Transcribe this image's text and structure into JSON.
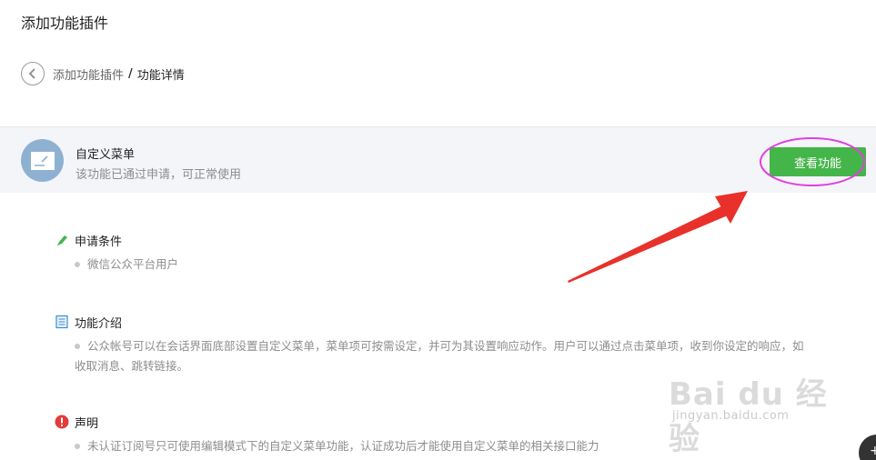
{
  "header": {
    "title": "添加功能插件"
  },
  "breadcrumb": {
    "parent": "添加功能插件",
    "separator": "/",
    "current": "功能详情"
  },
  "feature": {
    "name": "自定义菜单",
    "status": "该功能已通过申请，可正常使用",
    "view_button": "查看功能"
  },
  "sections": [
    {
      "title": "申请条件",
      "icon": "pencil-icon",
      "body": "微信公众平台用户"
    },
    {
      "title": "功能介绍",
      "icon": "document-icon",
      "body": "公众帐号可以在会话界面底部设置自定义菜单，菜单项可按需设定，并可为其设置响应动作。用户可以通过点击菜单项，收到你设定的响应，如收取消息、跳转链接。"
    },
    {
      "title": "声明",
      "icon": "warning-icon",
      "body": "未认证订阅号只可使用编辑模式下的自定义菜单功能，认证成功后才能使用自定义菜单的相关接口能力"
    }
  ],
  "watermark": {
    "logo": "Bai du 经验",
    "url": "jingyan.baidu.com"
  },
  "colors": {
    "accent": "#44b549",
    "annotation": "#e040e0",
    "arrow": "#e8312a",
    "icon_bg": "#8eb1d2",
    "warning": "#e33b3b"
  }
}
